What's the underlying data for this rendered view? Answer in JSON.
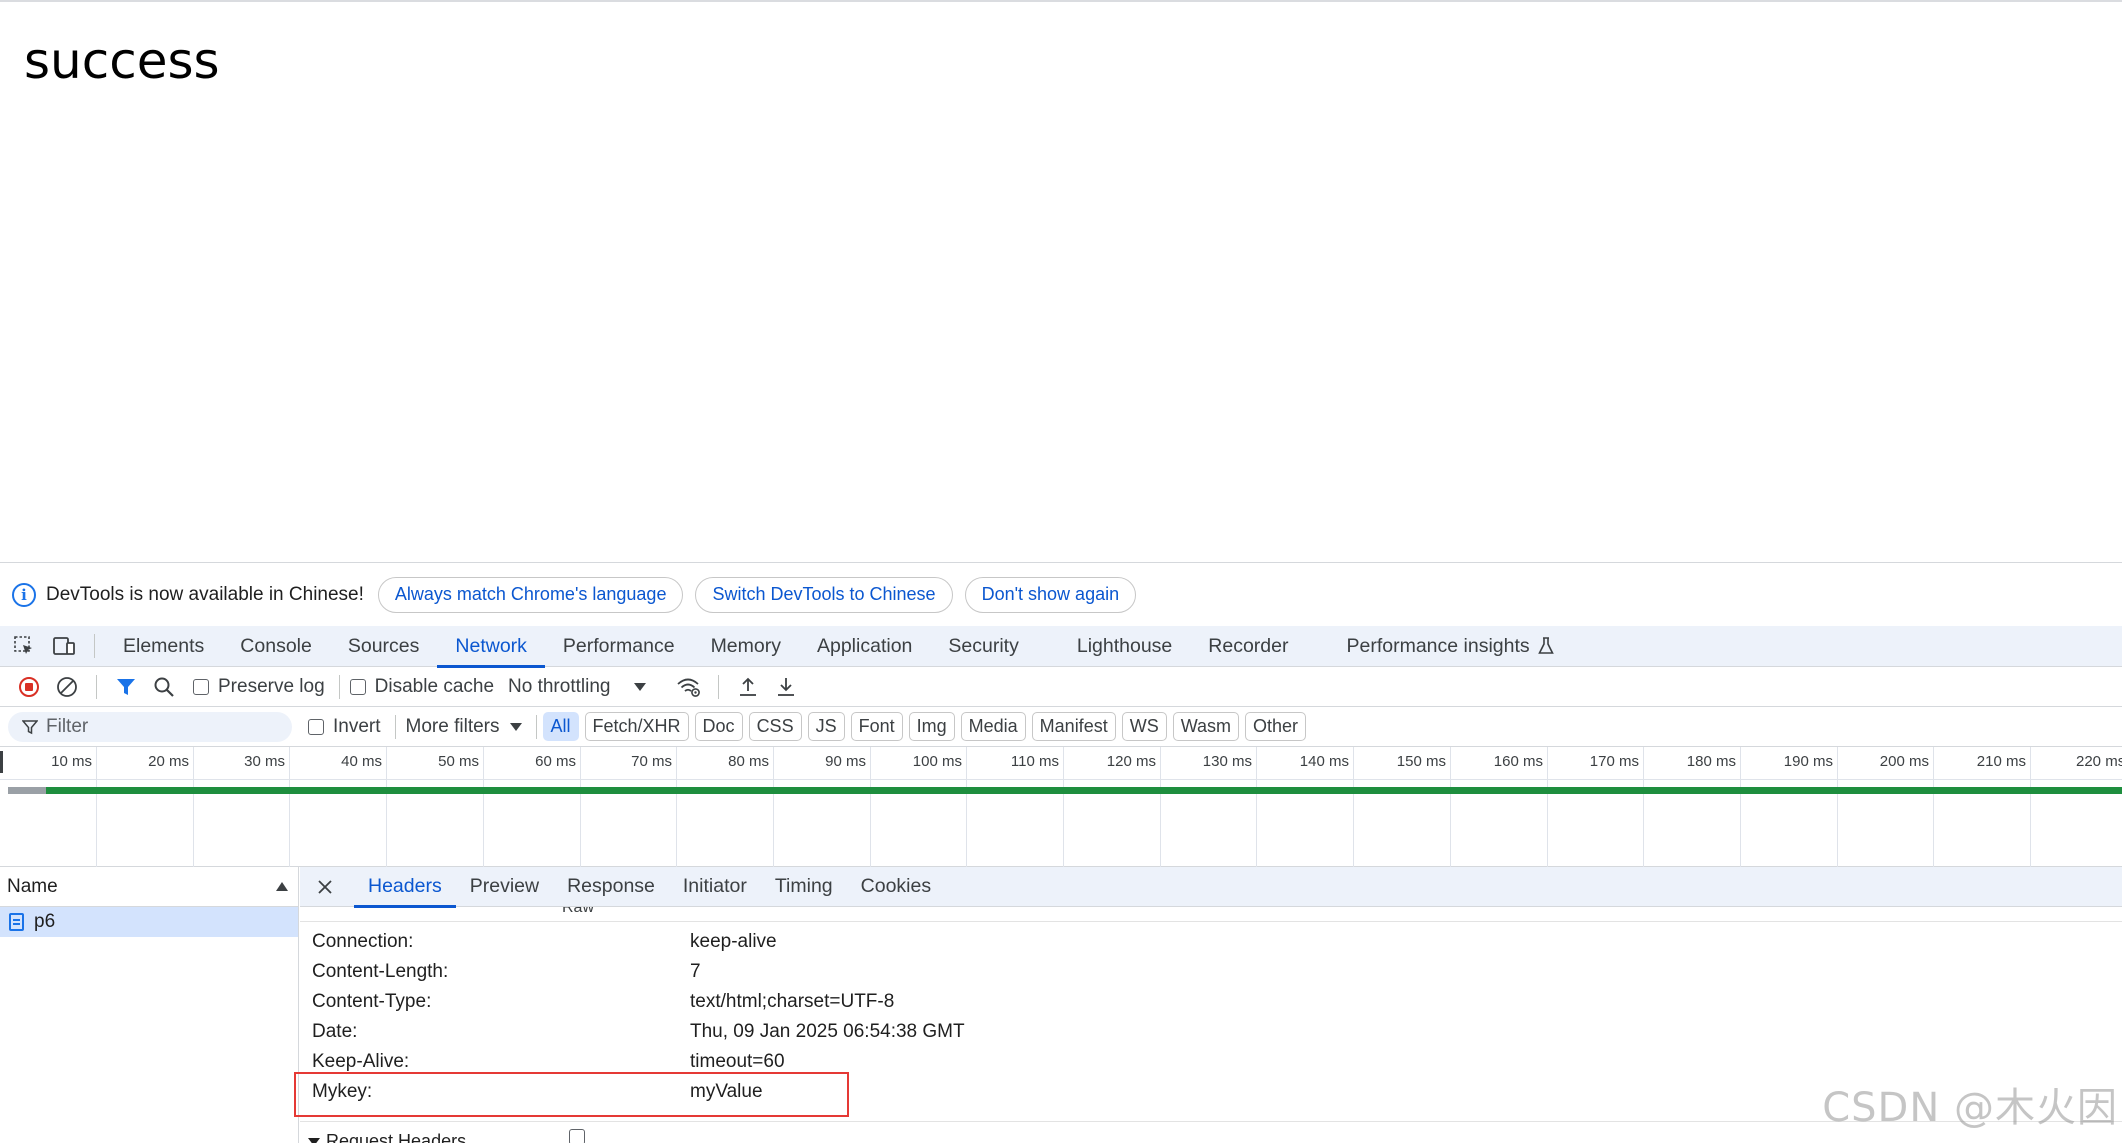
{
  "page": {
    "body_text": "success"
  },
  "infobar": {
    "message": "DevTools is now available in Chinese!",
    "buttons": [
      "Always match Chrome's language",
      "Switch DevTools to Chinese",
      "Don't show again"
    ]
  },
  "tabs": [
    "Elements",
    "Console",
    "Sources",
    "Network",
    "Performance",
    "Memory",
    "Application",
    "Security",
    "Lighthouse",
    "Recorder",
    "Performance insights"
  ],
  "toolbar": {
    "preserve_log": "Preserve log",
    "disable_cache": "Disable cache",
    "throttling": "No throttling"
  },
  "filterbar": {
    "filter_placeholder": "Filter",
    "invert": "Invert",
    "more_filters": "More filters",
    "types": [
      "All",
      "Fetch/XHR",
      "Doc",
      "CSS",
      "JS",
      "Font",
      "Img",
      "Media",
      "Manifest",
      "WS",
      "Wasm",
      "Other"
    ]
  },
  "timeline": {
    "ticks": [
      "10 ms",
      "20 ms",
      "30 ms",
      "40 ms",
      "50 ms",
      "60 ms",
      "70 ms",
      "80 ms",
      "90 ms",
      "100 ms",
      "110 ms",
      "120 ms",
      "130 ms",
      "140 ms",
      "150 ms",
      "160 ms",
      "170 ms",
      "180 ms",
      "190 ms",
      "200 ms",
      "210 ms",
      "220 ms"
    ]
  },
  "requests": {
    "column": "Name",
    "items": [
      "p6"
    ]
  },
  "detail": {
    "tabs": [
      "Headers",
      "Preview",
      "Response",
      "Initiator",
      "Timing",
      "Cookies"
    ],
    "clipped_label": "Raw",
    "response_headers": [
      {
        "key": "Connection:",
        "value": "keep-alive"
      },
      {
        "key": "Content-Length:",
        "value": "7"
      },
      {
        "key": "Content-Type:",
        "value": "text/html;charset=UTF-8"
      },
      {
        "key": "Date:",
        "value": "Thu, 09 Jan 2025 06:54:38 GMT"
      },
      {
        "key": "Keep-Alive:",
        "value": "timeout=60"
      },
      {
        "key": "Mykey:",
        "value": "myValue"
      }
    ],
    "request_headers_label": "Request Headers"
  },
  "watermark": "CSDN @木火因"
}
